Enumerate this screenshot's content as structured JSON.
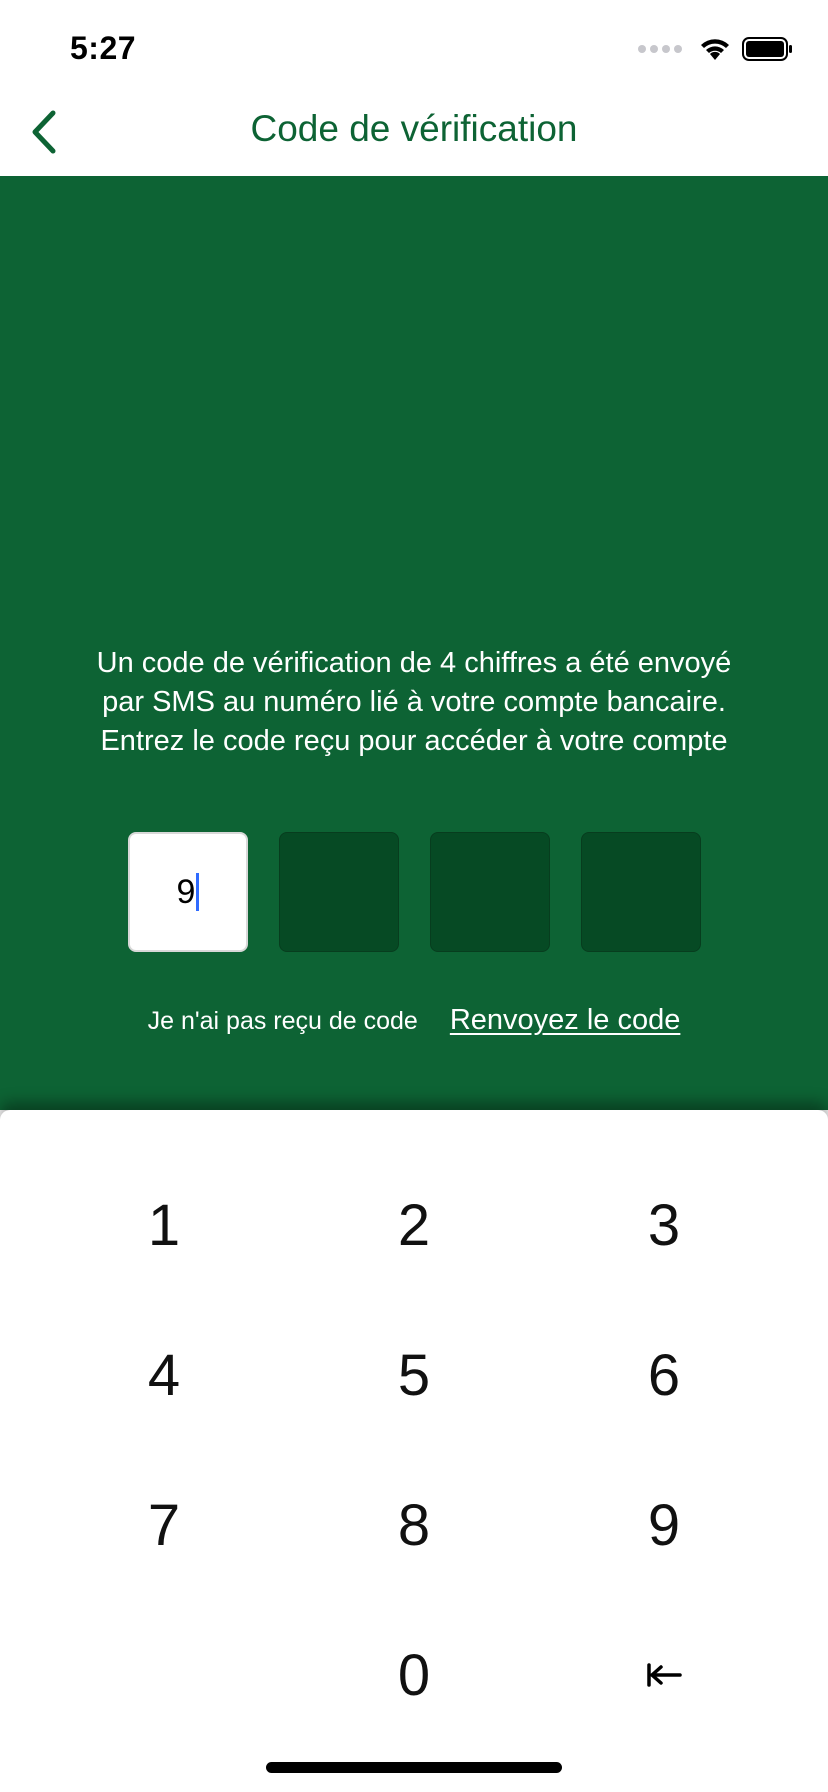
{
  "status_bar": {
    "time": "5:27"
  },
  "nav": {
    "title": "Code de vérification"
  },
  "instructions": {
    "line1": "Un code de vérification de 4 chiffres a été envoyé",
    "line2": "par SMS au numéro lié à votre compte bancaire.",
    "line3": "Entrez le code reçu pour accéder à votre compte"
  },
  "code": {
    "digits": [
      "9",
      "",
      "",
      ""
    ]
  },
  "resend": {
    "prompt": "Je n'ai pas reçu de code",
    "link": "Renvoyez le code"
  },
  "keypad": {
    "keys": [
      "1",
      "2",
      "3",
      "4",
      "5",
      "6",
      "7",
      "8",
      "9",
      "0"
    ],
    "backspace_icon": "backspace-arrow-icon"
  },
  "colors": {
    "brand_green": "#0d6334",
    "box_dark": "#064a24",
    "caret": "#2f6bff"
  }
}
